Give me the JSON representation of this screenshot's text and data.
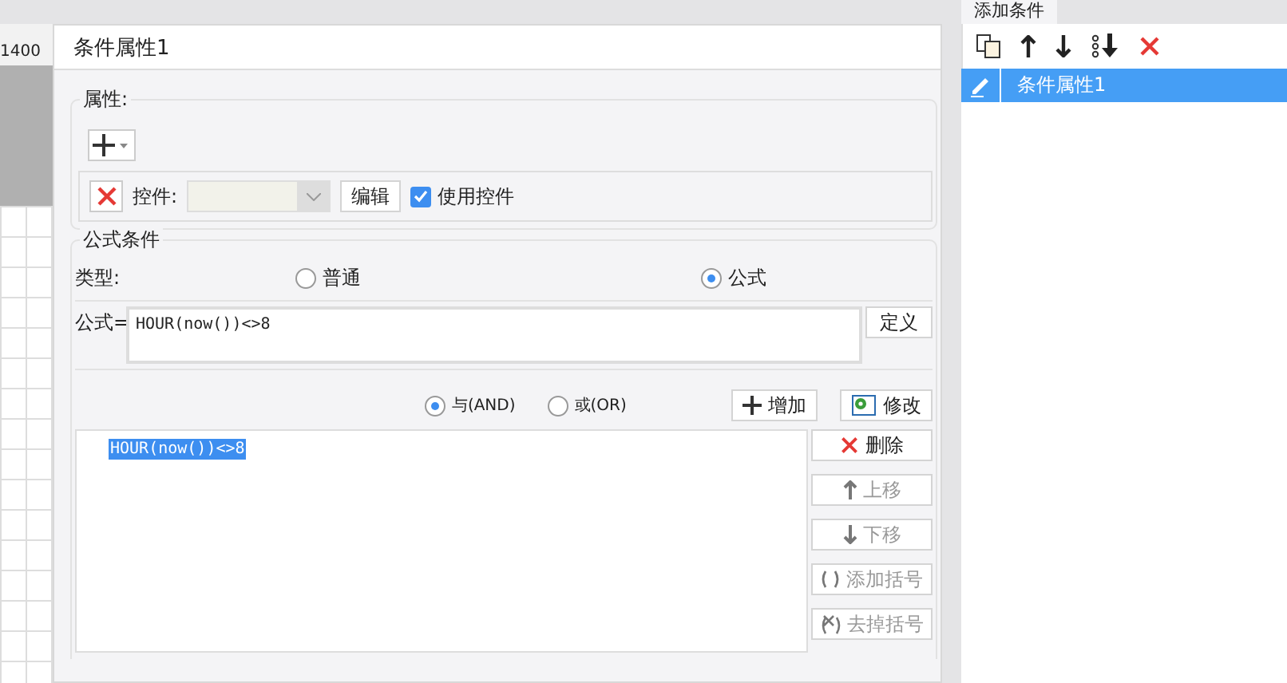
{
  "ruler": {
    "label": "1400"
  },
  "side_tab": {
    "label": "添加条件"
  },
  "dialog": {
    "title": "条件属性1",
    "properties": {
      "legend": "属性:",
      "control_label": "控件:",
      "edit_button": "编辑",
      "use_control": {
        "label": "使用控件",
        "checked": true
      }
    },
    "formula_condition": {
      "legend": "公式条件",
      "type_label": "类型:",
      "types": [
        {
          "label": "普通",
          "selected": false
        },
        {
          "label": "公式",
          "selected": true
        }
      ],
      "formula_label": "公式=",
      "formula_value": "HOUR(now())<>8",
      "define_button": "定义",
      "joins": [
        {
          "label": "与(AND)",
          "selected": true
        },
        {
          "label": "或(OR)",
          "selected": false
        }
      ],
      "add_button": "增加",
      "modify_button": "修改",
      "conditions": [
        {
          "text": "HOUR(now())<>8",
          "selected": true
        }
      ],
      "actions": [
        {
          "kind": "delete",
          "label": "删除",
          "disabled": false
        },
        {
          "kind": "up",
          "label": "上移",
          "disabled": true
        },
        {
          "kind": "down",
          "label": "下移",
          "disabled": true
        },
        {
          "kind": "paren",
          "label": "添加括号",
          "disabled": true
        },
        {
          "kind": "unparen",
          "label": "去掉括号",
          "disabled": true
        }
      ]
    }
  },
  "condition_list": {
    "items": [
      {
        "label": "条件属性1",
        "selected": true
      }
    ]
  }
}
